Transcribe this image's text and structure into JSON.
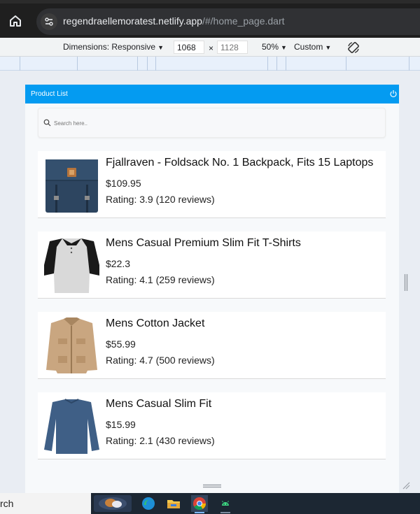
{
  "browser": {
    "url_host": "regendraellemoratest.netlify.app",
    "url_path": "/#/home_page.dart"
  },
  "device_toolbar": {
    "dimensions_label": "Dimensions: Responsive",
    "width_value": "1068",
    "height_value": "1128",
    "times": "×",
    "zoom": "50%",
    "throttle": "Custom"
  },
  "app": {
    "title": "Product List",
    "search_placeholder": "Search here..",
    "accent_color": "#049bf1"
  },
  "products": [
    {
      "title": "Fjallraven - Foldsack No. 1 Backpack, Fits 15 Laptops",
      "price": "$109.95",
      "rating": "Rating: 3.9 (120 reviews)",
      "image": "backpack"
    },
    {
      "title": "Mens Casual Premium Slim Fit T-Shirts",
      "price": "$22.3",
      "rating": "Rating: 4.1 (259 reviews)",
      "image": "tshirt"
    },
    {
      "title": "Mens Cotton Jacket",
      "price": "$55.99",
      "rating": "Rating: 4.7 (500 reviews)",
      "image": "jacket"
    },
    {
      "title": "Mens Casual Slim Fit",
      "price": "$15.99",
      "rating": "Rating: 2.1 (430 reviews)",
      "image": "longsleeve"
    }
  ],
  "taskbar": {
    "search_fragment": "rch"
  }
}
